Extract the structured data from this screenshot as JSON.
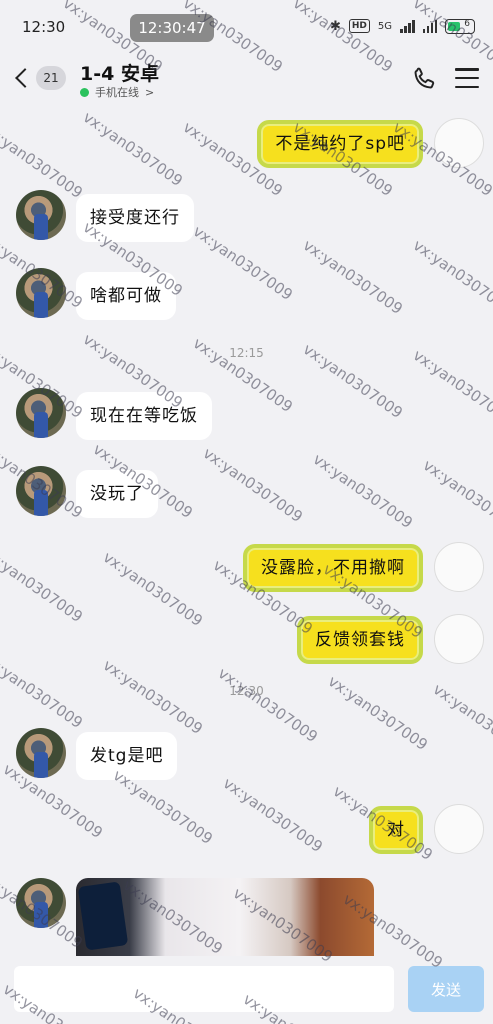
{
  "status_bar": {
    "time": "12:30",
    "clock_chip": "12:30:47",
    "network_label": "5G",
    "hd_label": "HD",
    "battery_level": "6",
    "battery_fraction": 0.06,
    "accent_green": "#27c26b"
  },
  "header": {
    "back_badge": "21",
    "title": "1-4 安卓",
    "subtitle": "手机在线",
    "subtitle_chevron": ">",
    "call_icon": "phone-icon",
    "menu_icon": "menu-icon"
  },
  "messages": [
    {
      "side": "self",
      "text": "不是纯约了sp吧"
    },
    {
      "side": "peer",
      "text": "接受度还行"
    },
    {
      "side": "peer",
      "text": "啥都可做"
    },
    {
      "side": "peer",
      "text": "现在在等吃饭"
    },
    {
      "side": "peer",
      "text": "没玩了"
    },
    {
      "side": "self",
      "text": "没露脸，不用撤啊"
    },
    {
      "side": "self",
      "text": "反馈领套钱"
    },
    {
      "side": "peer",
      "text": "发tg是吧"
    },
    {
      "side": "self",
      "text": "对"
    },
    {
      "side": "peer",
      "type": "image"
    }
  ],
  "time_dividers": [
    "12:15",
    "12:30"
  ],
  "input": {
    "value": "",
    "send_label": "发送",
    "send_color": "#a9d2f4"
  },
  "watermark": "vx:yan0307009",
  "colors": {
    "self_bubble": "#f6e01e",
    "peer_bubble": "#ffffff",
    "background": "#f1f1f4"
  }
}
